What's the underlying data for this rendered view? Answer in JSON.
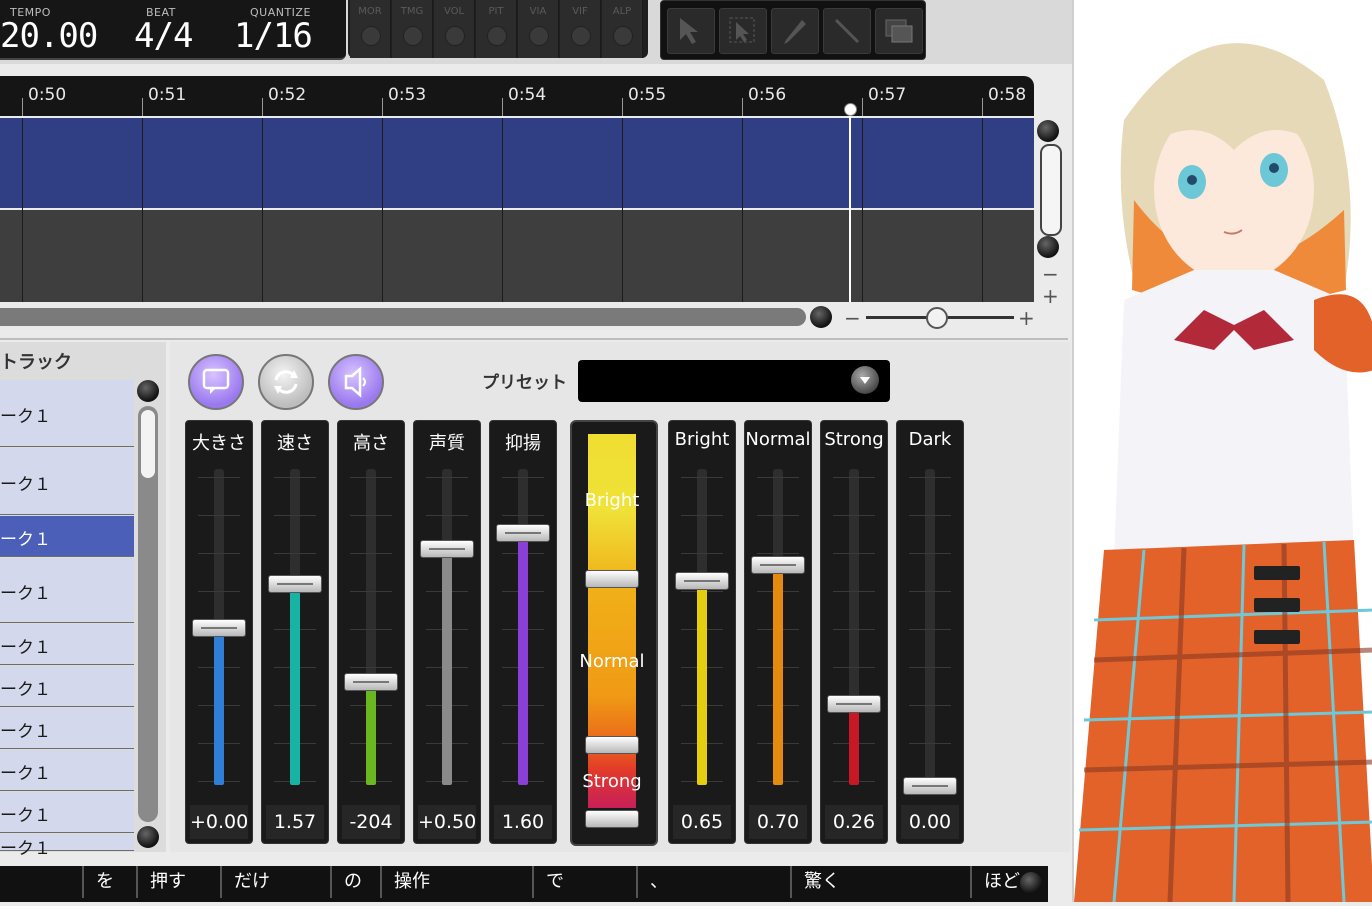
{
  "transport": {
    "tempo_label": "TEMPO",
    "tempo_value": "20.00",
    "beat_label": "BEAT",
    "beat_value": "4/4",
    "quantize_label": "QUANTIZE",
    "quantize_value": "1/16"
  },
  "mini_tools": [
    "MOR",
    "TMG",
    "VOL",
    "PIT",
    "VIA",
    "VIF",
    "ALP"
  ],
  "edit_tools": [
    "pointer-icon",
    "select-arrow-icon",
    "pencil-icon",
    "line-icon",
    "layers-icon"
  ],
  "ruler": {
    "ticks": [
      "0:50",
      "0:51",
      "0:52",
      "0:53",
      "0:54",
      "0:55",
      "0:56",
      "0:57",
      "0:58"
    ]
  },
  "zoom": {
    "minus": "−",
    "plus": "+"
  },
  "tracks": {
    "title": "トラック",
    "items": [
      "ーク１",
      "ーク１",
      "ーク１",
      "ーク１",
      "ーク１",
      "ーク１",
      "ーク１",
      "ーク１",
      "ーク１",
      "ーク１"
    ],
    "selected_index": 2
  },
  "panel": {
    "preset_label": "プリセット",
    "preset_value": "",
    "faders": [
      {
        "label": "大きさ",
        "value": "+0.00",
        "level": 0.5,
        "color": "#2f7fd6"
      },
      {
        "label": "速さ",
        "value": "1.57",
        "level": 0.64,
        "color": "#17b3a5"
      },
      {
        "label": "高さ",
        "value": "-204",
        "level": 0.33,
        "color": "#6ab81f"
      },
      {
        "label": "声質",
        "value": "+0.50",
        "level": 0.75,
        "color": "#8a8a8a"
      },
      {
        "label": "抑揚",
        "value": "1.60",
        "level": 0.8,
        "color": "#8a3fd6"
      },
      {
        "label": "Bright",
        "value": "0.65",
        "level": 0.65,
        "color": "#e3cf10"
      },
      {
        "label": "Normal",
        "value": "0.70",
        "level": 0.7,
        "color": "#e48a0e"
      },
      {
        "label": "Strong",
        "value": "0.26",
        "level": 0.26,
        "color": "#c81826"
      },
      {
        "label": "Dark",
        "value": "0.00",
        "level": 0.0,
        "color": "#555555"
      }
    ],
    "emotion_map": {
      "labels": [
        "Bright",
        "Normal",
        "Strong"
      ]
    }
  },
  "lyrics": [
    "を",
    "押す",
    "だけ",
    "の",
    "操作",
    "で",
    "、",
    "驚く",
    "ほど"
  ]
}
